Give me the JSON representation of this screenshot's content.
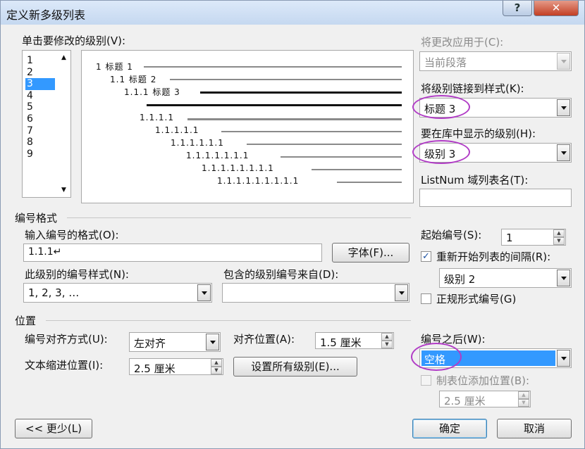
{
  "title": "定义新多级列表",
  "help_btn": "?",
  "close_btn": "✕",
  "levels_label": "单击要修改的级别(V):",
  "levels": [
    "1",
    "2",
    "3",
    "4",
    "5",
    "6",
    "7",
    "8",
    "9"
  ],
  "selected_level_index": 2,
  "preview": {
    "lines": [
      "1 标题 1",
      "1.1 标题 2",
      "1.1.1 标题 3",
      "1.1.1.1",
      "1.1.1.1.1",
      "1.1.1.1.1.1",
      "1.1.1.1.1.1.1",
      "1.1.1.1.1.1.1.1",
      "1.1.1.1.1.1.1.1.1"
    ]
  },
  "apply_to": {
    "label": "将更改应用于(C):",
    "value": "当前段落"
  },
  "link_style": {
    "label": "将级别链接到样式(K):",
    "value": "标题 3"
  },
  "gallery_level": {
    "label": "要在库中显示的级别(H):",
    "value": "级别 3"
  },
  "listnum": {
    "label": "ListNum 域列表名(T):",
    "value": ""
  },
  "number_format_section": "编号格式",
  "enter_format": {
    "label": "输入编号的格式(O):",
    "value": "1.1.1↵"
  },
  "font_btn": "字体(F)...",
  "start_at": {
    "label": "起始编号(S):",
    "value": "1"
  },
  "restart": {
    "label": "重新开始列表的间隔(R):",
    "checked": "✓",
    "value": "级别 2"
  },
  "legal": {
    "label": "正规形式编号(G)"
  },
  "number_style": {
    "label": "此级别的编号样式(N):",
    "value": "1, 2, 3, …"
  },
  "include_from": {
    "label": "包含的级别编号来自(D):",
    "value": ""
  },
  "position_section": "位置",
  "alignment": {
    "label": "编号对齐方式(U):",
    "value": "左对齐"
  },
  "aligned_at": {
    "label": "对齐位置(A):",
    "value": "1.5 厘米"
  },
  "indent": {
    "label": "文本缩进位置(I):",
    "value": "2.5 厘米"
  },
  "set_all_btn": "设置所有级别(E)...",
  "follow": {
    "label": "编号之后(W):",
    "value": "空格"
  },
  "tab_stop": {
    "label": "制表位添加位置(B):",
    "value": "2.5 厘米"
  },
  "less_btn": "<< 更少(L)",
  "ok_btn": "确定",
  "cancel_btn": "取消",
  "colors": {
    "accent": "#3399ff",
    "highlight": "#b13cc6"
  }
}
